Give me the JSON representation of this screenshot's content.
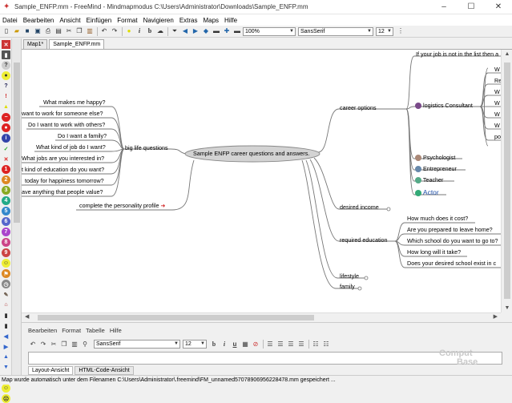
{
  "window": {
    "title": "Sample_ENFP.mm - FreeMind - Mindmapmodus C:\\Users\\Administrator\\Downloads\\Sample_ENFP.mm",
    "minimize": "–",
    "maximize": "☐",
    "close": "✕"
  },
  "menu": [
    "Datei",
    "Bearbeiten",
    "Ansicht",
    "Einfügen",
    "Format",
    "Navigieren",
    "Extras",
    "Maps",
    "Hilfe"
  ],
  "toolbar": {
    "zoom": "100%",
    "font": "SansSerif",
    "size": "12"
  },
  "tabs": [
    "Map1*",
    "Sample_ENFP.mm"
  ],
  "map": {
    "root": "Sample ENFP career questions and answers.",
    "left": {
      "branch": "big life questions",
      "questions": [
        "What makes me happy?",
        "want to work for someone else?",
        "Do I want to work with others?",
        "Do I want a family?",
        "What kind of job do I want?",
        "What jobs are you interested in?",
        "t kind of education do you want?",
        "today for happiness tomorrow?",
        "ave anything that people value?"
      ],
      "profile": "complete the personality profile"
    },
    "right": {
      "career_options": "career options",
      "career_top": "If your job is not in the list then a",
      "logistics": "logistics Consultant",
      "logistics_children": [
        "W",
        "Re",
        "W",
        "W",
        "W",
        "W",
        "po"
      ],
      "psychologist": "Psychologist",
      "entrepreneur": "Entrepreneur",
      "teacher": "Teacher",
      "actor": "Actor",
      "desired_income": "desired income",
      "required_education": "required education",
      "education_questions": [
        "How much does it cost?",
        "Are you prepared to leave home?",
        "Which school do you want to go to?",
        "How long will it take?",
        "Does your desired school exist in c"
      ],
      "lifestyle": "lifestyle",
      "family": "family"
    }
  },
  "notes": {
    "menu": [
      "Bearbeiten",
      "Format",
      "Tabelle",
      "Hilfe"
    ],
    "font": "SansSerif",
    "size": "12",
    "view_tabs": [
      "Layout-Ansicht",
      "HTML-Code-Ansicht"
    ]
  },
  "status": "Map wurde automatisch unter dem Filenamen C:\\Users\\Administrator\\.freemind\\FM_unnamed5707890695622847​8.mm gespeichert ...",
  "watermark": [
    "Comput",
    "Base"
  ],
  "colors": {
    "edge": "#777777",
    "root_fill": "#d3d3d3",
    "actor_text": "#1f4fa8",
    "arrow": "#d11f1f"
  }
}
